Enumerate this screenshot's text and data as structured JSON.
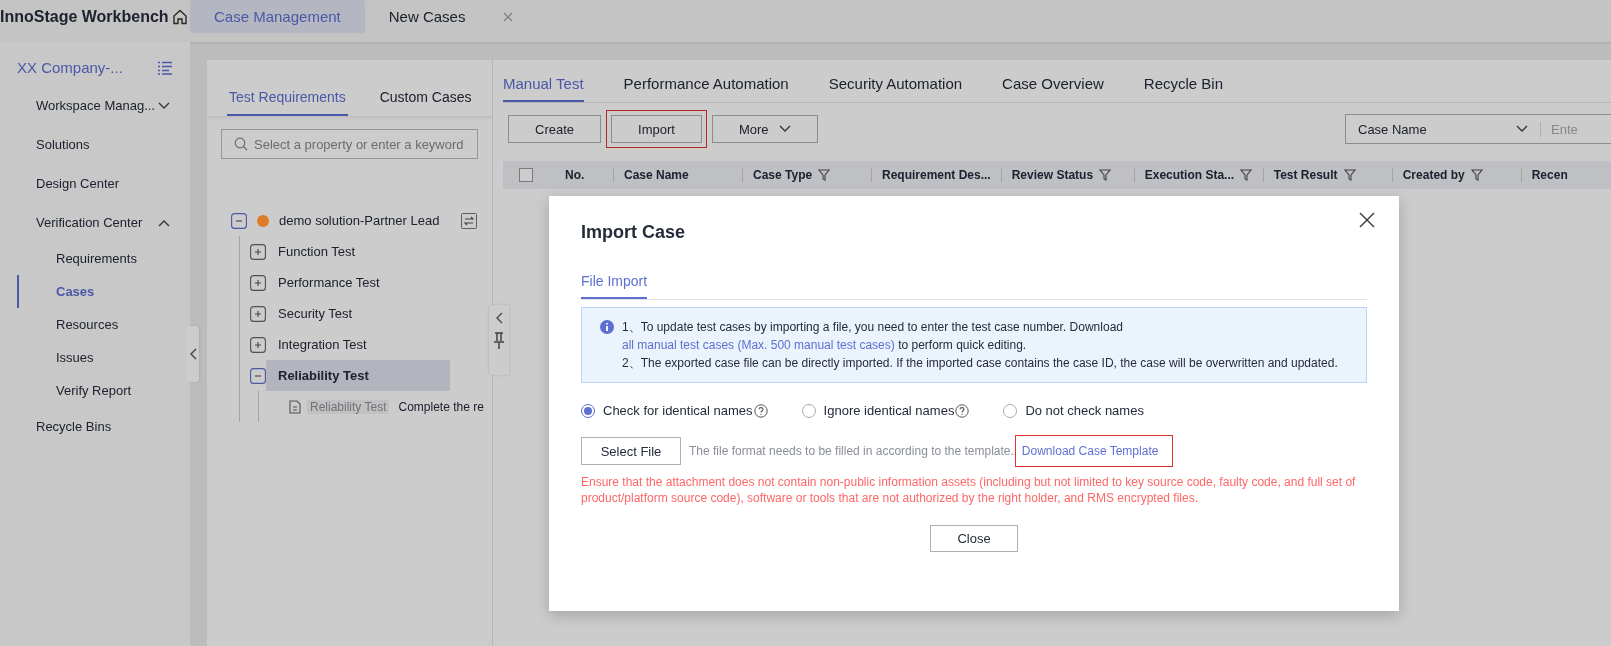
{
  "header": {
    "title": "InnoStage Workbench",
    "tabs": [
      {
        "label": "Case Management",
        "selected": true,
        "closable": false
      },
      {
        "label": "New Cases",
        "selected": false,
        "closable": true
      }
    ]
  },
  "sidebar": {
    "workspace": "XX Company-...",
    "items": [
      {
        "label": "Workspace Manag...",
        "selected": false,
        "expanded": false
      },
      {
        "label": "Solutions",
        "selected": false
      },
      {
        "label": "Design Center",
        "selected": false
      },
      {
        "label": "Verification Center",
        "selected": false,
        "expanded": true,
        "children": [
          {
            "label": "Requirements",
            "selected": false
          },
          {
            "label": "Cases",
            "selected": true
          },
          {
            "label": "Resources",
            "selected": false
          },
          {
            "label": "Issues",
            "selected": false
          },
          {
            "label": "Verify Report",
            "selected": false
          }
        ]
      },
      {
        "label": "Recycle Bins",
        "selected": false
      }
    ]
  },
  "tree": {
    "tabs": [
      {
        "label": "Test Requirements",
        "selected": true
      },
      {
        "label": "Custom Cases",
        "selected": false
      }
    ],
    "search": {
      "placeholder": "Select a property or enter a keyword"
    },
    "nodes": [
      {
        "label": "demo solution-Partner Lead",
        "color": "#e07b2a",
        "expanded": true,
        "selected": false,
        "children": [
          {
            "label": "Function Test",
            "expanded": false,
            "selected": false
          },
          {
            "label": "Performance Test",
            "expanded": false,
            "selected": false
          },
          {
            "label": "Security Test",
            "expanded": false,
            "selected": false
          },
          {
            "label": "Integration Test",
            "expanded": false,
            "selected": false
          },
          {
            "label": "Reliability Test",
            "expanded": true,
            "selected": true,
            "children": [
              {
                "kind": "case",
                "label": "Reliability Test",
                "description": "Complete the re"
              }
            ]
          }
        ]
      }
    ]
  },
  "main": {
    "tabs": [
      {
        "label": "Manual Test",
        "selected": true
      },
      {
        "label": "Performance Automation",
        "selected": false
      },
      {
        "label": "Security Automation",
        "selected": false
      },
      {
        "label": "Case Overview",
        "selected": false
      },
      {
        "label": "Recycle Bin",
        "selected": false
      }
    ],
    "toolbar": [
      {
        "kind": "button",
        "label": "Create",
        "highlighted": false
      },
      {
        "kind": "button",
        "label": "Import",
        "highlighted": true
      },
      {
        "kind": "menu",
        "label": "More",
        "highlighted": false
      }
    ],
    "filter": {
      "field": "Case Name",
      "placeholder": "Ente"
    },
    "table": {
      "select_all": {
        "checked": false
      },
      "columns": [
        {
          "label": "No.",
          "filter": false
        },
        {
          "label": "Case Name",
          "filter": false
        },
        {
          "label": "Case Type",
          "filter": true
        },
        {
          "label": "Requirement Des...",
          "filter": false
        },
        {
          "label": "Review Status",
          "filter": true
        },
        {
          "label": "Execution Sta...",
          "filter": true
        },
        {
          "label": "Test Result",
          "filter": true
        },
        {
          "label": "Created by",
          "filter": true
        },
        {
          "label": "Recen",
          "filter": false
        }
      ]
    }
  },
  "dialog": {
    "title": "Import Case",
    "tabs": [
      {
        "label": "File Import",
        "selected": true
      }
    ],
    "notice": [
      {
        "number": "1、",
        "text": "To update test cases by importing a file, you need to enter the test case number. Download ",
        "link": "all manual test cases (Max. 500 manual test cases)",
        "after": " to perform quick editing."
      },
      {
        "number": "2、",
        "text": "The exported case file can be directly imported. If the imported case contains the case ID, the case will be overwritten and updated."
      }
    ],
    "options": [
      {
        "label": "Check for identical names",
        "selected": true,
        "help": true
      },
      {
        "label": "Ignore identical names",
        "selected": false,
        "help": true
      },
      {
        "label": "Do not check names",
        "selected": false,
        "help": false
      }
    ],
    "file": {
      "button": "Select File",
      "hint": "The file format needs to be filled in according to the template.",
      "link": {
        "label": "Download Case Template",
        "highlighted": true
      }
    },
    "warning": "Ensure that the attachment does not contain non-public information assets (including but not limited to key source code, faulty code, and full set of product/platform source code), software or tools that are not authorized by the right holder, and RMS encrypted files.",
    "close": "Close"
  }
}
